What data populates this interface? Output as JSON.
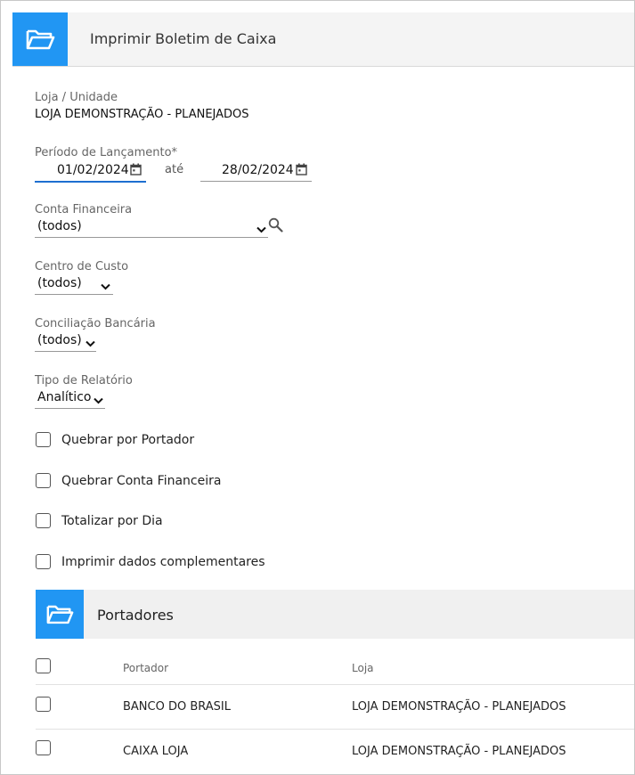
{
  "header": {
    "title": "Imprimir Boletim de Caixa"
  },
  "form": {
    "loja": {
      "label": "Loja / Unidade",
      "value": "LOJA DEMONSTRAÇÃO - PLANEJADOS"
    },
    "periodo": {
      "label": "Período de Lançamento*",
      "start": "01/02/2024",
      "separator": "até",
      "end": "28/02/2024"
    },
    "conta_financeira": {
      "label": "Conta Financeira",
      "value": "(todos)"
    },
    "centro_custo": {
      "label": "Centro de Custo",
      "value": "(todos)"
    },
    "conciliacao": {
      "label": "Conciliação Bancária",
      "value": "(todos)"
    },
    "tipo_relatorio": {
      "label": "Tipo de Relatório",
      "value": "Analítico"
    }
  },
  "options": [
    {
      "label": "Quebrar por Portador",
      "checked": false
    },
    {
      "label": "Quebrar Conta Financeira",
      "checked": false
    },
    {
      "label": "Totalizar por Dia",
      "checked": false
    },
    {
      "label": "Imprimir dados complementares",
      "checked": false
    }
  ],
  "portadores": {
    "title": "Portadores",
    "columns": [
      "Portador",
      "Loja"
    ],
    "rows": [
      {
        "portador": "BANCO DO BRASIL",
        "loja": "LOJA DEMONSTRAÇÃO - PLANEJADOS"
      },
      {
        "portador": "CAIXA LOJA",
        "loja": "LOJA DEMONSTRAÇÃO - PLANEJADOS"
      }
    ]
  },
  "colors": {
    "accent": "#2196f3",
    "active_underline": "#1e6fd0"
  },
  "icons": {
    "header": "folder-open-icon",
    "calendar": "calendar-icon",
    "search": "search-icon",
    "chevron": "chevron-down-icon"
  }
}
